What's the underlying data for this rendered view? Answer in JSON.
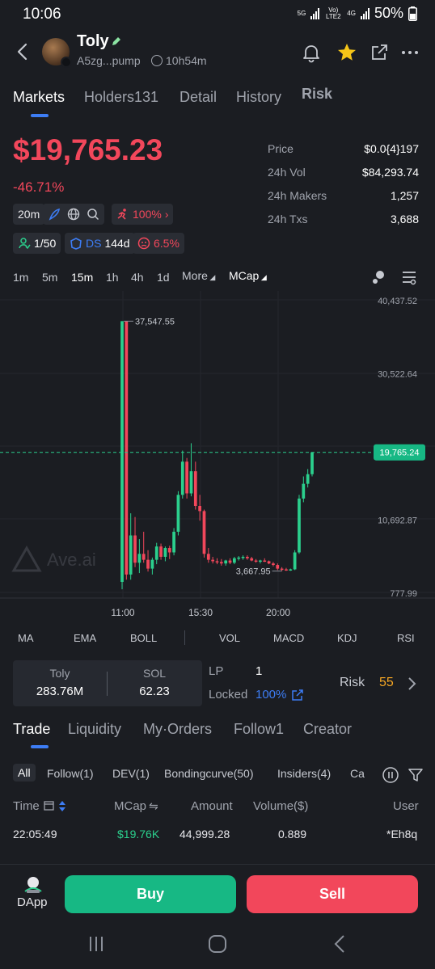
{
  "status": {
    "time": "10:06",
    "net1": "5G",
    "net2": "Vo) LTE2",
    "net3": "4G",
    "battery": "50%"
  },
  "header": {
    "title": "Toly",
    "address": "A5zg...pump",
    "age": "10h54m"
  },
  "tabs": [
    "Markets",
    "Holders131",
    "Detail",
    "History",
    "Risk"
  ],
  "price": {
    "main": "$19,765.23",
    "change": "-46.71%"
  },
  "stats": [
    {
      "k": "Price",
      "v": "$0.0{4}197"
    },
    {
      "k": "24h Vol",
      "v": "$84,293.74"
    },
    {
      "k": "24h Makers",
      "v": "1,257"
    },
    {
      "k": "24h Txs",
      "v": "3,688"
    }
  ],
  "chips": {
    "interval": "20m",
    "boost": "100%",
    "holders": "1/50",
    "ds_label": "DS",
    "ds_value": "144d",
    "risk_pct": "6.5%"
  },
  "timeframes": [
    "1m",
    "5m",
    "15m",
    "1h",
    "4h",
    "1d",
    "More",
    "MCap"
  ],
  "chart_data": {
    "type": "candlestick",
    "metric": "MCap",
    "y_ticks": [
      "40,437.52",
      "30,522.64",
      "10,692.87",
      "777.99"
    ],
    "x_ticks": [
      "11:00",
      "15:30",
      "20:00"
    ],
    "high_label": "37,547.55",
    "low_label": "3,667.95",
    "current_label": "19,765.24",
    "watermark": "Ave.ai",
    "candles": [
      [
        2200,
        37547,
        1200,
        37547
      ],
      [
        37547,
        37547,
        2500,
        3200
      ],
      [
        3200,
        11500,
        2500,
        8500
      ],
      [
        8500,
        11000,
        4200,
        4800
      ],
      [
        4800,
        8000,
        3400,
        6000
      ],
      [
        6000,
        9000,
        4800,
        5200
      ],
      [
        5200,
        6500,
        3600,
        4000
      ],
      [
        4000,
        5500,
        3200,
        5200
      ],
      [
        5200,
        7500,
        4600,
        7000
      ],
      [
        7000,
        7400,
        5200,
        5600
      ],
      [
        5600,
        7000,
        5000,
        6800
      ],
      [
        6800,
        7100,
        5300,
        6200
      ],
      [
        6200,
        9500,
        5800,
        9000
      ],
      [
        9000,
        14500,
        8500,
        14000
      ],
      [
        14000,
        20000,
        13500,
        18500
      ],
      [
        18500,
        19000,
        13500,
        14200
      ],
      [
        14200,
        21000,
        13800,
        17200
      ],
      [
        17200,
        18500,
        12000,
        12500
      ],
      [
        12500,
        14000,
        10500,
        11800
      ],
      [
        11800,
        12000,
        5500,
        6000
      ],
      [
        6000,
        6800,
        4800,
        5200
      ],
      [
        5200,
        5600,
        4700,
        5000
      ],
      [
        5000,
        5400,
        4600,
        4900
      ],
      [
        4900,
        5300,
        4400,
        4700
      ],
      [
        4700,
        5200,
        4400,
        5100
      ],
      [
        5100,
        5400,
        4600,
        4800
      ],
      [
        4800,
        5600,
        4600,
        5400
      ],
      [
        5400,
        5700,
        5100,
        5500
      ],
      [
        5500,
        5800,
        5200,
        5600
      ],
      [
        5600,
        5800,
        5200,
        5400
      ],
      [
        5400,
        5600,
        5000,
        5100
      ],
      [
        5100,
        5300,
        4800,
        5000
      ],
      [
        5000,
        5200,
        4700,
        5100
      ],
      [
        5100,
        5400,
        4900,
        5000
      ],
      [
        5000,
        5100,
        4600,
        4700
      ],
      [
        4700,
        4900,
        4300,
        4500
      ],
      [
        4500,
        4700,
        3800,
        4000
      ],
      [
        4000,
        4200,
        3667,
        3900
      ],
      [
        3900,
        4100,
        3700,
        3800
      ],
      [
        3800,
        4000,
        3700,
        3900
      ],
      [
        3900,
        6500,
        3800,
        6200
      ],
      [
        6200,
        14000,
        6000,
        13500
      ],
      [
        13500,
        16500,
        13000,
        15500
      ],
      [
        15500,
        17500,
        15000,
        16800
      ],
      [
        16800,
        19765,
        16500,
        19765
      ]
    ]
  },
  "indicators": [
    "MA",
    "EMA",
    "BOLL",
    "VOL",
    "MACD",
    "KDJ",
    "RSI"
  ],
  "pair": {
    "base_label": "Toly",
    "base_value": "283.76M",
    "quote_label": "SOL",
    "quote_value": "62.23"
  },
  "lp": {
    "label": "LP",
    "value": "1",
    "locked_label": "Locked",
    "locked_value": "100%"
  },
  "risk": {
    "label": "Risk",
    "score": "55"
  },
  "lower_tabs": [
    "Trade",
    "Liquidity",
    "My·Orders",
    "Follow1",
    "Creator"
  ],
  "filter_tabs": [
    "All",
    "Follow(1)",
    "DEV(1)",
    "Bondingcurve(50)",
    "Insiders(4)",
    "Ca"
  ],
  "table": {
    "headers": [
      "Time",
      "MCap",
      "Amount",
      "Volume($)",
      "User"
    ],
    "rows": [
      {
        "time": "22:05:49",
        "mcap": "$19.76K",
        "amount": "44,999.28",
        "volume": "0.889",
        "user": "*Eh8q"
      }
    ]
  },
  "bottom": {
    "dapp": "DApp",
    "buy": "Buy",
    "sell": "Sell"
  },
  "colors": {
    "up": "#2bcf8d",
    "down": "#f2475b",
    "accent": "#3d7df5",
    "buy": "#17b884",
    "sell": "#f2475b"
  }
}
